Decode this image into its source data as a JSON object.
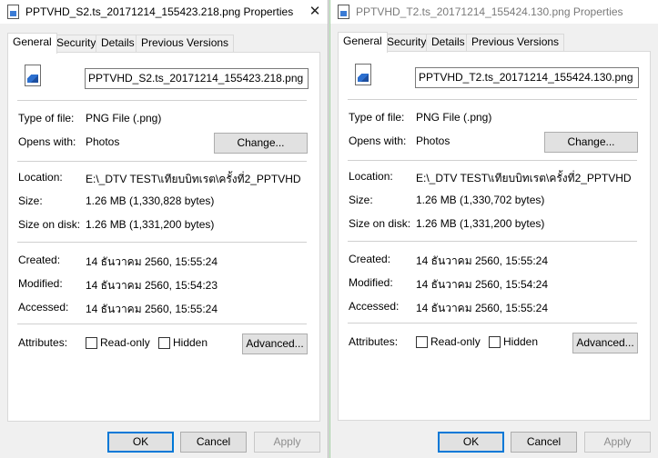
{
  "windows": [
    {
      "title": "PPTVHD_S2.ts_20171214_155423.218.png Properties",
      "close_glyph": "✕",
      "tabs": [
        {
          "label": "General",
          "active": true
        },
        {
          "label": "Security"
        },
        {
          "label": "Details"
        },
        {
          "label": "Previous Versions"
        }
      ],
      "file_name": "PPTVHD_S2.ts_20171214_155423.218.png",
      "type_label": "Type of file:",
      "type_value": "PNG File (.png)",
      "opens_label": "Opens with:",
      "opens_value": "Photos",
      "change_label": "Change...",
      "location_label": "Location:",
      "location_value": "E:\\_DTV TEST\\เทียบบิทเรต\\ครั้งที่2_PPTVHD",
      "size_label": "Size:",
      "size_value": "1.26 MB (1,330,828 bytes)",
      "size_on_disk_label": "Size on disk:",
      "size_on_disk_value": "1.26 MB (1,331,200 bytes)",
      "created_label": "Created:",
      "created_value": "14 ธันวาคม 2560, 15:55:24",
      "modified_label": "Modified:",
      "modified_value": "14 ธันวาคม 2560, 15:54:23",
      "accessed_label": "Accessed:",
      "accessed_value": "14 ธันวาคม 2560, 15:55:24",
      "attributes_label": "Attributes:",
      "readonly_label": "Read-only",
      "hidden_label": "Hidden",
      "advanced_label": "Advanced...",
      "ok_label": "OK",
      "cancel_label": "Cancel",
      "apply_label": "Apply"
    },
    {
      "title": "PPTVHD_T2.ts_20171214_155424.130.png Properties",
      "tabs": [
        {
          "label": "General",
          "active": true
        },
        {
          "label": "Security"
        },
        {
          "label": "Details"
        },
        {
          "label": "Previous Versions"
        }
      ],
      "file_name": "PPTVHD_T2.ts_20171214_155424.130.png",
      "type_label": "Type of file:",
      "type_value": "PNG File (.png)",
      "opens_label": "Opens with:",
      "opens_value": "Photos",
      "change_label": "Change...",
      "location_label": "Location:",
      "location_value": "E:\\_DTV TEST\\เทียบบิทเรต\\ครั้งที่2_PPTVHD",
      "size_label": "Size:",
      "size_value": "1.26 MB (1,330,702 bytes)",
      "size_on_disk_label": "Size on disk:",
      "size_on_disk_value": "1.26 MB (1,331,200 bytes)",
      "created_label": "Created:",
      "created_value": "14 ธันวาคม 2560, 15:55:24",
      "modified_label": "Modified:",
      "modified_value": "14 ธันวาคม 2560, 15:54:24",
      "accessed_label": "Accessed:",
      "accessed_value": "14 ธันวาคม 2560, 15:55:24",
      "attributes_label": "Attributes:",
      "readonly_label": "Read-only",
      "hidden_label": "Hidden",
      "advanced_label": "Advanced...",
      "ok_label": "OK",
      "cancel_label": "Cancel",
      "apply_label": "Apply"
    }
  ],
  "colors": {
    "default_button_border": "#0078d7",
    "window_background": "#f0f0f0",
    "panel_background": "#ffffff"
  }
}
